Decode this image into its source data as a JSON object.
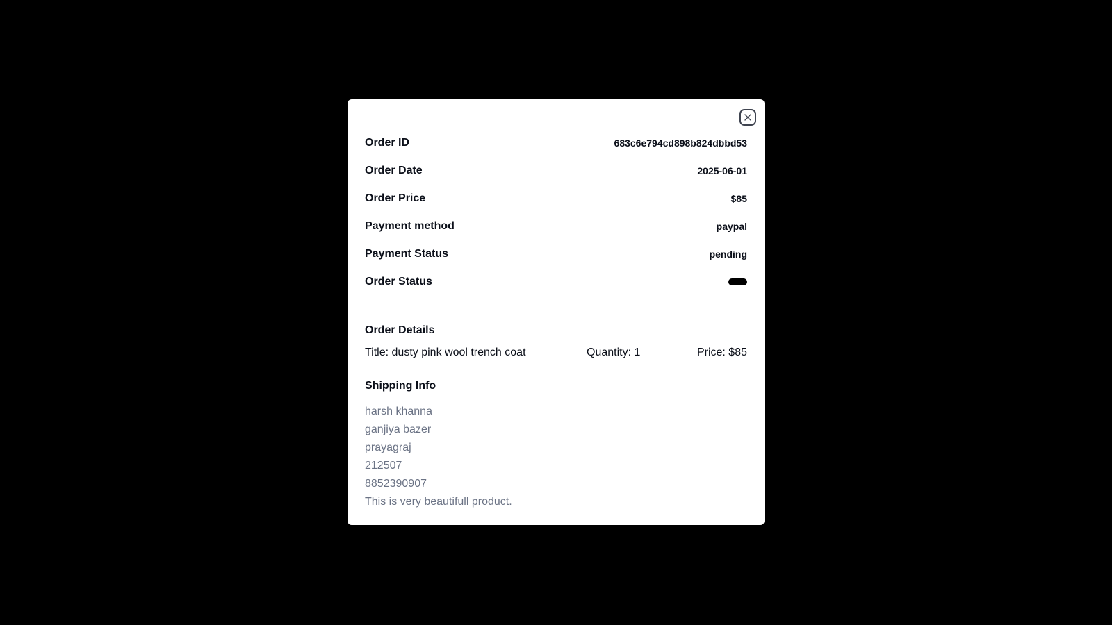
{
  "order": {
    "rows": [
      {
        "label": "Order ID",
        "value": "683c6e794cd898b824dbbd53"
      },
      {
        "label": "Order Date",
        "value": "2025-06-01"
      },
      {
        "label": "Order Price",
        "value": "$85"
      },
      {
        "label": "Payment method",
        "value": "paypal"
      },
      {
        "label": "Payment Status",
        "value": "pending"
      },
      {
        "label": "Order Status",
        "value": ""
      }
    ]
  },
  "details": {
    "title": "Order Details",
    "item": {
      "title": "Title: dusty pink wool trench coat",
      "quantity": "Quantity: 1",
      "price": "Price: $85"
    }
  },
  "shipping": {
    "title": "Shipping Info",
    "lines": [
      "harsh khanna",
      "ganjiya bazer",
      "prayagraj",
      "212507",
      "8852390907",
      "This is very beautifull product."
    ]
  },
  "icons": {
    "close": "close-icon"
  },
  "colors": {
    "backdrop": "#000000",
    "status_pill": "#000000",
    "muted_text": "#6b7385"
  }
}
